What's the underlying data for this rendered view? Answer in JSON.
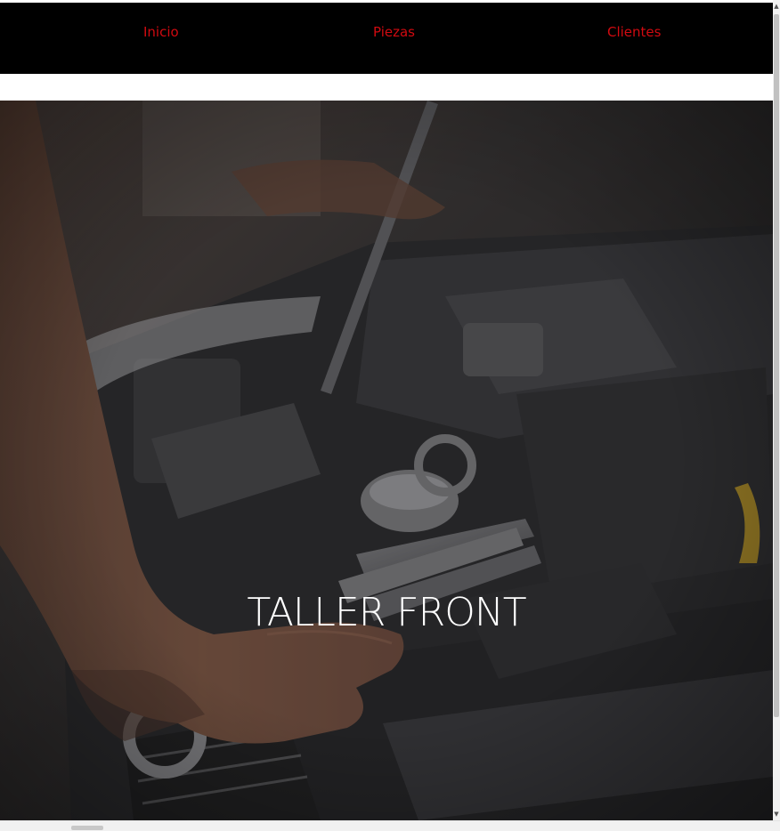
{
  "nav": {
    "items": [
      {
        "label": "Inicio"
      },
      {
        "label": "Piezas"
      },
      {
        "label": "Clientes"
      }
    ],
    "link_color": "#d10a10",
    "background": "#000000"
  },
  "hero": {
    "title": "TALLER FRONT",
    "image_description_icon": "mechanic-engine-photo",
    "overlay_color": "#1c1c1e"
  }
}
